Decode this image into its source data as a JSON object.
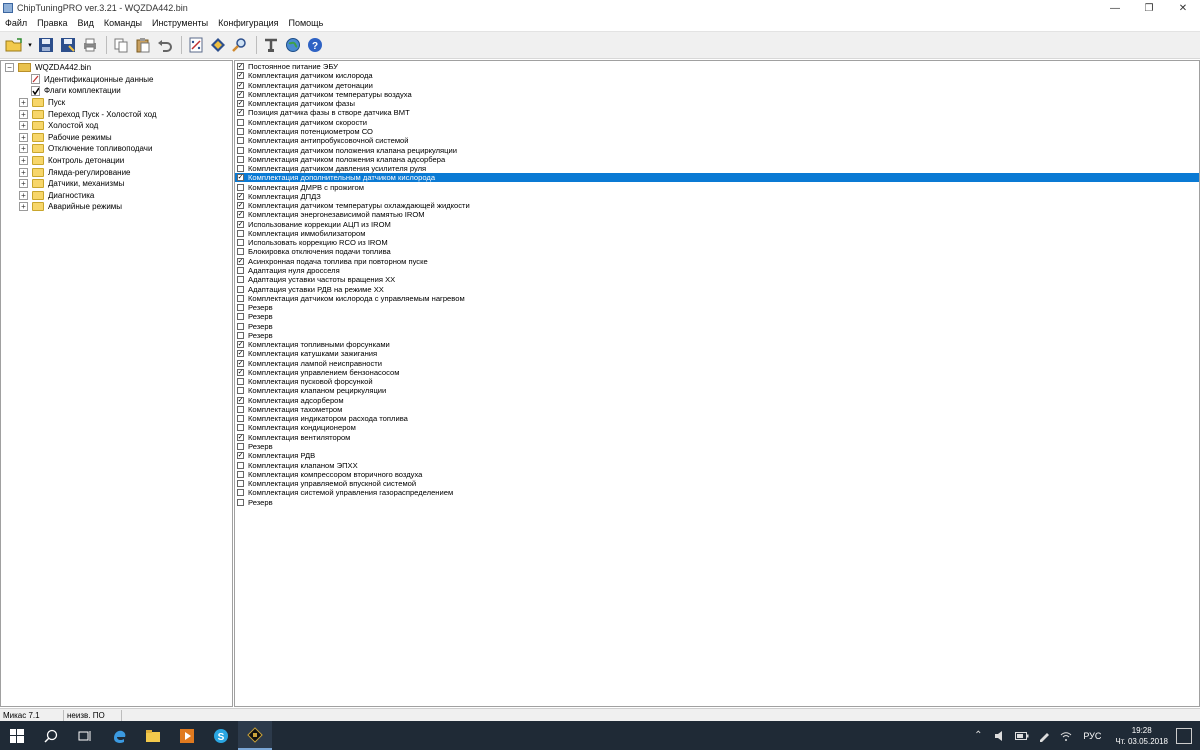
{
  "window": {
    "title": "ChipTuningPRO ver.3.21 - WQZDA442.bin",
    "controls": {
      "minimize": "—",
      "maximize": "❐",
      "close": "✕"
    }
  },
  "menu": [
    "Файл",
    "Правка",
    "Вид",
    "Команды",
    "Инструменты",
    "Конфигурация",
    "Помощь"
  ],
  "toolbar": {
    "icons": [
      "open-icon",
      "save-icon",
      "save-as-icon",
      "print-icon",
      "copy-icon",
      "paste-icon",
      "undo-icon",
      "calc-icon",
      "diamond-icon",
      "search-icon",
      "tools-icon",
      "globe-icon",
      "help-icon"
    ]
  },
  "tree": {
    "root": "WQZDA442.bin",
    "leaves": [
      "Идентификационные данные",
      "Флаги комплектации"
    ],
    "folders": [
      "Пуск",
      "Переход Пуск - Холостой ход",
      "Холостой ход",
      "Рабочие режимы",
      "Отключение топливоподачи",
      "Контроль детонации",
      "Лямда-регулирование",
      "Датчики, механизмы",
      "Диагностика",
      "Аварийные режимы"
    ]
  },
  "flags": [
    {
      "label": "Постоянное питание ЭБУ",
      "checked": true
    },
    {
      "label": "Комплектация датчиком кислорода",
      "checked": true
    },
    {
      "label": "Комплектация датчиком детонации",
      "checked": true
    },
    {
      "label": "Комплектация датчиком температуры воздуха",
      "checked": true
    },
    {
      "label": "Комплектация датчиком фазы",
      "checked": true
    },
    {
      "label": "Позиция датчика фазы в створе датчика ВМТ",
      "checked": true
    },
    {
      "label": "Комплектация датчиком скорости",
      "checked": false
    },
    {
      "label": "Комплектация потенциометром СО",
      "checked": false
    },
    {
      "label": "Комплектация антипробуксовочной системой",
      "checked": false
    },
    {
      "label": "Комплектация датчиком положения клапана рециркуляции",
      "checked": false
    },
    {
      "label": "Комплектация датчиком положения клапана адсорбера",
      "checked": false
    },
    {
      "label": "Комплектация датчиком давления усилителя руля",
      "checked": false
    },
    {
      "label": "Комплектация дополнительным датчиком кислорода",
      "checked": true,
      "selected": true
    },
    {
      "label": "Комплектация ДМРВ с прожигом",
      "checked": false
    },
    {
      "label": "Комплектация ДПДЗ",
      "checked": true
    },
    {
      "label": "Комплектация датчиком температуры охлаждающей жидкости",
      "checked": true
    },
    {
      "label": "Комплектация энергонезависимой памятью IROM",
      "checked": true
    },
    {
      "label": "Использование коррекции АЦП из IROM",
      "checked": true
    },
    {
      "label": "Комплектация иммобилизатором",
      "checked": false
    },
    {
      "label": "Использовать коррекцию RCO из IROM",
      "checked": false
    },
    {
      "label": "Блокировка отключения подачи топлива",
      "checked": false
    },
    {
      "label": "Асинхронная подача топлива при повторном пуске",
      "checked": true
    },
    {
      "label": "Адаптация нуля дросселя",
      "checked": false
    },
    {
      "label": "Адаптация уставки частоты вращения ХХ",
      "checked": false
    },
    {
      "label": "Адаптация уставки РДВ на режиме ХХ",
      "checked": false
    },
    {
      "label": "Комплектация датчиком кислорода с управляемым нагревом",
      "checked": false
    },
    {
      "label": "Резерв",
      "checked": false
    },
    {
      "label": "Резерв",
      "checked": false
    },
    {
      "label": "Резерв",
      "checked": false
    },
    {
      "label": "Резерв",
      "checked": false
    },
    {
      "label": "Комплектация топливными форсунками",
      "checked": true
    },
    {
      "label": "Комплектация катушками зажигания",
      "checked": true
    },
    {
      "label": "Комплектация лампой неисправности",
      "checked": true
    },
    {
      "label": "Комплектация управлением бензонасосом",
      "checked": true
    },
    {
      "label": "Комплектация пусковой форсункой",
      "checked": false
    },
    {
      "label": "Комплектация клапаном рециркуляции",
      "checked": false
    },
    {
      "label": "Комплектация адсорбером",
      "checked": true
    },
    {
      "label": "Комплектация тахометром",
      "checked": false
    },
    {
      "label": "Комплектация индикатором расхода топлива",
      "checked": false
    },
    {
      "label": "Комплектация кондиционером",
      "checked": false
    },
    {
      "label": "Комплектация вентилятором",
      "checked": true
    },
    {
      "label": "Резерв",
      "checked": false
    },
    {
      "label": "Комплектация РДВ",
      "checked": true
    },
    {
      "label": "Комплектация клапаном ЭПХХ",
      "checked": false
    },
    {
      "label": "Комплектация компрессором вторичного воздуха",
      "checked": false
    },
    {
      "label": "Комплектация управляемой впускной системой",
      "checked": false
    },
    {
      "label": "Комплектация системой управления газораспределением",
      "checked": false
    },
    {
      "label": "Резерв",
      "checked": false
    }
  ],
  "status": {
    "ecu": "Микас 7.1",
    "software": "неизв. ПО"
  },
  "taskbar": {
    "apps": [
      "windows-start-icon",
      "search-icon",
      "task-view-icon",
      "edge-icon",
      "file-explorer-icon",
      "media-player-icon",
      "skype-icon",
      "chiptuning-icon"
    ],
    "lang": "РУС",
    "time": "19:28",
    "date": "Чт. 03.05.2018"
  },
  "colors": {
    "selection": "#0a7ad4",
    "taskbar": "#1f2a36"
  }
}
